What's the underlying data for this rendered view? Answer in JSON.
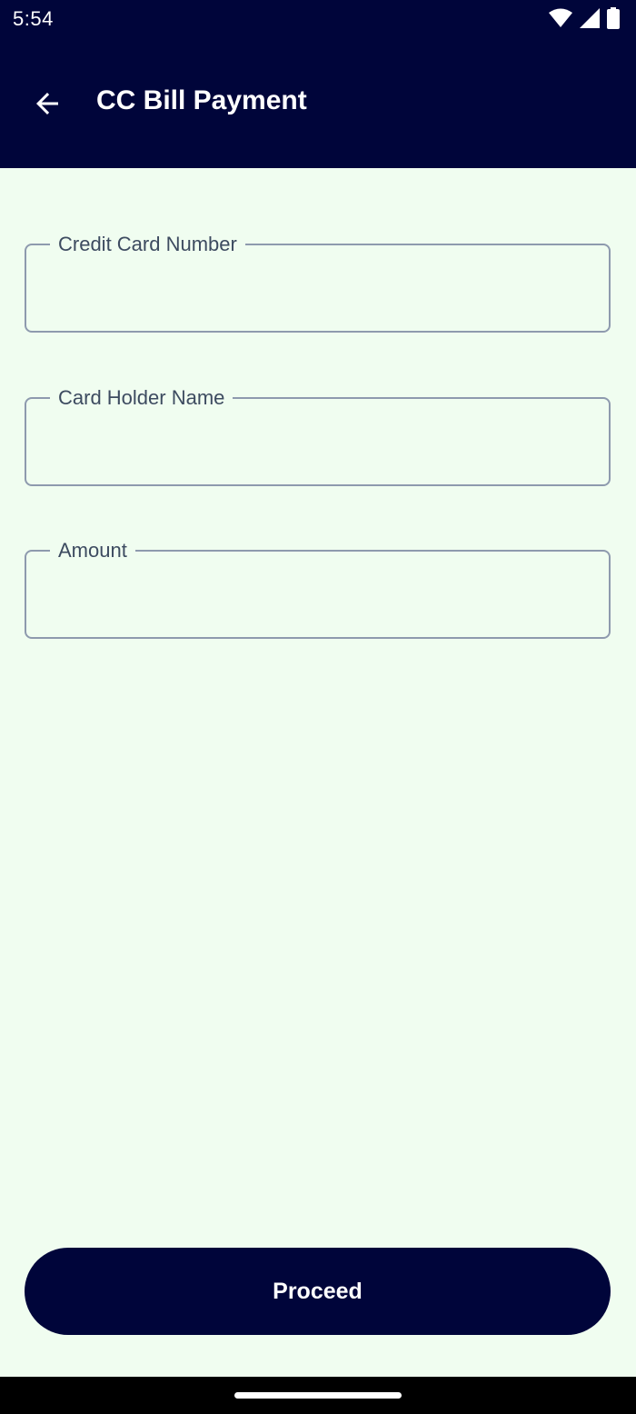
{
  "status_bar": {
    "time": "5:54",
    "icons": [
      "wifi-icon",
      "cell-signal-icon",
      "battery-icon"
    ]
  },
  "app_bar": {
    "title": "CC Bill Payment",
    "back_icon": "arrow-back-icon"
  },
  "form": {
    "fields": [
      {
        "label": "Credit Card Number",
        "value": ""
      },
      {
        "label": "Card Holder Name",
        "value": ""
      },
      {
        "label": "Amount",
        "value": ""
      }
    ]
  },
  "actions": {
    "proceed_label": "Proceed"
  },
  "colors": {
    "primary": "#00053A",
    "background": "#F0FDF0",
    "field_border": "#8E9AAE",
    "label_text": "#3D4B60",
    "on_primary": "#FFFFFF"
  }
}
